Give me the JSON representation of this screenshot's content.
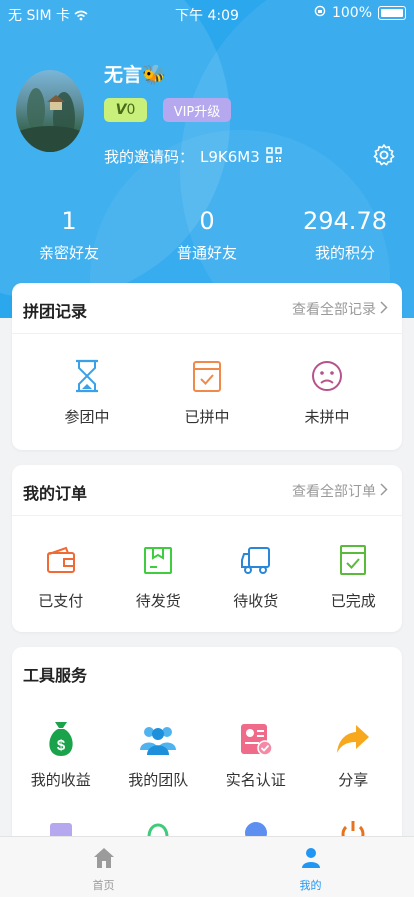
{
  "status_bar": {
    "carrier": "无 SIM 卡",
    "time": "下午 4:09",
    "battery": "100%"
  },
  "profile": {
    "username": "无言🐝",
    "vip_level": "0",
    "vip_upgrade_label": "VIP升级",
    "invite_label": "我的邀请码：",
    "invite_code": "L9K6M3"
  },
  "stats": [
    {
      "value": "1",
      "label": "亲密好友"
    },
    {
      "value": "0",
      "label": "普通好友"
    },
    {
      "value": "294.78",
      "label": "我的积分"
    }
  ],
  "group_records": {
    "title": "拼团记录",
    "link": "查看全部记录",
    "items": [
      {
        "label": "参团中",
        "icon": "hourglass-icon"
      },
      {
        "label": "已拼中",
        "icon": "calendar-check-icon"
      },
      {
        "label": "未拼中",
        "icon": "sad-face-icon"
      }
    ]
  },
  "orders": {
    "title": "我的订单",
    "link": "查看全部订单",
    "items": [
      {
        "label": "已支付",
        "icon": "wallet-icon"
      },
      {
        "label": "待发货",
        "icon": "package-icon"
      },
      {
        "label": "待收货",
        "icon": "truck-icon"
      },
      {
        "label": "已完成",
        "icon": "checked-doc-icon"
      }
    ]
  },
  "tools": {
    "title": "工具服务",
    "items": [
      {
        "label": "我的收益",
        "icon": "money-bag-icon"
      },
      {
        "label": "我的团队",
        "icon": "team-icon"
      },
      {
        "label": "实名认证",
        "icon": "id-card-icon"
      },
      {
        "label": "分享",
        "icon": "share-arrow-icon"
      }
    ]
  },
  "tabbar": [
    {
      "label": "首页",
      "icon": "home-icon",
      "active": false
    },
    {
      "label": "我的",
      "icon": "user-icon",
      "active": true
    }
  ],
  "colors": {
    "header": "#2ba7ee",
    "active_tab": "#2196f3",
    "vip_badge": "#c8f07a",
    "vip_upgrade": "#b5a8ee"
  }
}
